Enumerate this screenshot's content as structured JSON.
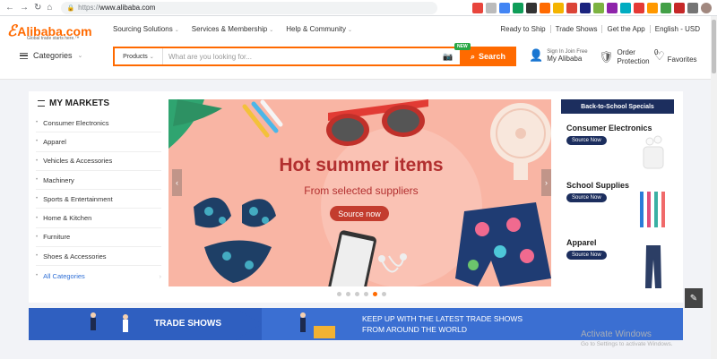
{
  "browser": {
    "url_proto": "https://",
    "url_host": "www.alibaba.com"
  },
  "header": {
    "logo_text": "Alibaba.com",
    "logo_tagline": "Global trade starts here.™",
    "nav": [
      "Sourcing Solutions",
      "Services & Membership",
      "Help & Community"
    ],
    "right_links": [
      "Ready to Ship",
      "Trade Shows",
      "Get the App",
      "English - USD"
    ],
    "categories_label": "Categories",
    "search": {
      "dropdown": "Products",
      "placeholder": "What are you looking for...",
      "button_label": "Search",
      "new_badge": "NEW"
    },
    "signin_top": "Sign In  Join Free",
    "signin_bottom": "My Alibaba",
    "order_line1": "Order",
    "order_line2": "Protection",
    "favorites_count": "0",
    "favorites_label": "Favorites"
  },
  "markets": {
    "title": "MY MARKETS",
    "items": [
      "Consumer Electronics",
      "Apparel",
      "Vehicles & Accessories",
      "Machinery",
      "Sports & Entertainment",
      "Home & Kitchen",
      "Furniture",
      "Shoes & Accessories",
      "All Categories"
    ]
  },
  "banner": {
    "headline": "Hot summer items",
    "subline": "From selected suppliers",
    "cta": "Source now",
    "dots": 6,
    "active_dot": 4
  },
  "specials": {
    "header": "Back-to-School Specials",
    "items": [
      {
        "name": "Consumer Electronics",
        "button": "Source Now"
      },
      {
        "name": "School Supplies",
        "button": "Source Now"
      },
      {
        "name": "Apparel",
        "button": "Source Now"
      }
    ]
  },
  "trade": {
    "label": "TRADE SHOWS",
    "line1": "KEEP UP WITH THE LATEST TRADE SHOWS",
    "line2": "FROM AROUND THE WORLD"
  },
  "watermark": {
    "line1": "Activate Windows",
    "line2": "Go to Settings to activate Windows."
  },
  "colors": {
    "brand": "#ff6a00",
    "navy": "#1c2e5e",
    "banner_bg": "#f9b5a4"
  }
}
